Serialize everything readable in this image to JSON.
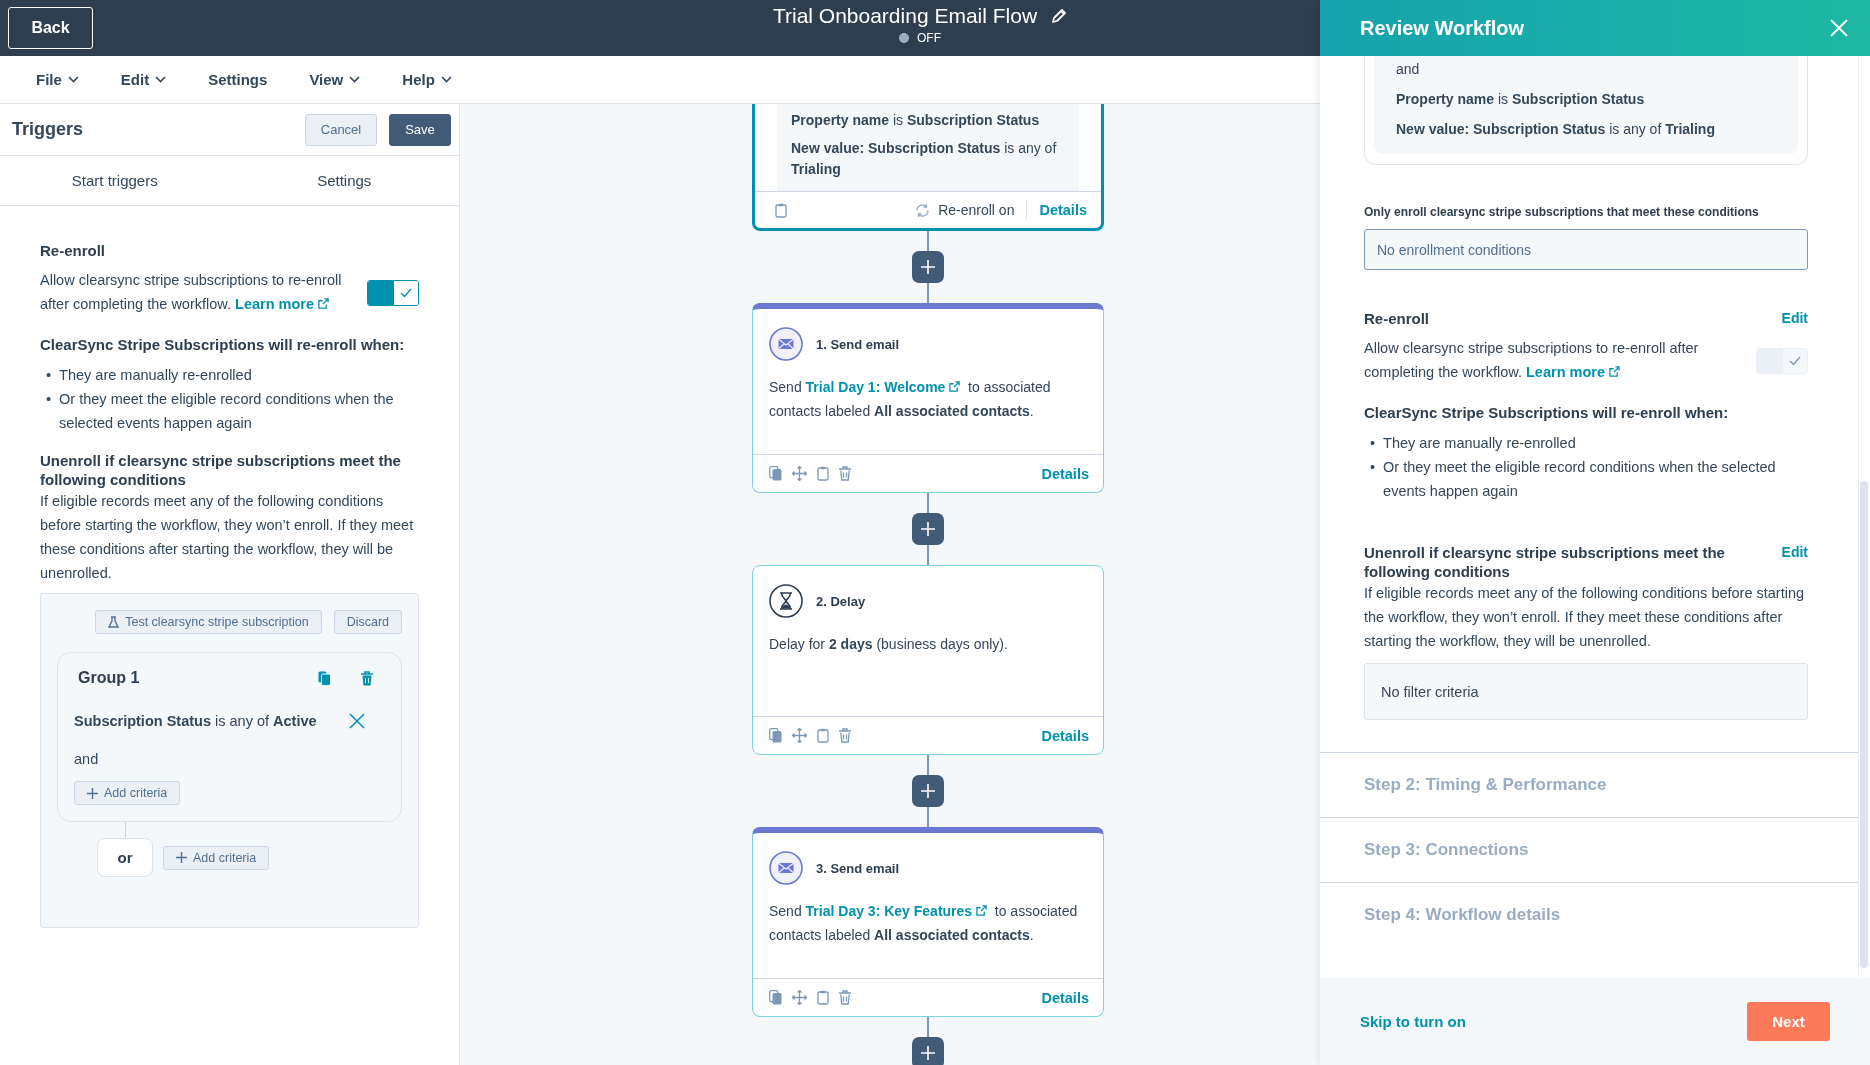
{
  "top_bar": {
    "back": "Back",
    "title": "Trial Onboarding Email Flow",
    "status": "OFF",
    "is_on": false
  },
  "menu": [
    {
      "label": "File",
      "dropdown": true
    },
    {
      "label": "Edit",
      "dropdown": true
    },
    {
      "label": "Settings",
      "dropdown": false
    },
    {
      "label": "View",
      "dropdown": true
    },
    {
      "label": "Help",
      "dropdown": true
    }
  ],
  "triggers_panel": {
    "title": "Triggers",
    "cancel": "Cancel",
    "save": "Save",
    "tabs": [
      "Start triggers",
      "Settings"
    ],
    "reenroll": {
      "title": "Re-enroll",
      "text": "Allow clearsync stripe subscriptions to re-enroll after completing the workflow.",
      "link": "Learn more",
      "on": true,
      "disabled": false
    },
    "when_title": "ClearSync Stripe Subscriptions will re-enroll when:",
    "bullet_marker": "•",
    "bullets": [
      "They are manually re-enrolled",
      "Or they meet the eligible record conditions when the selected events happen again"
    ],
    "unenroll_title": "Unenroll if clearsync stripe subscriptions meet the following conditions",
    "unenroll_text": "If eligible records meet any of the following conditions before starting the workflow, they won’t enroll. If they meet these conditions after starting the workflow, they will be unenrolled.",
    "test_button": "Test clearsync stripe subscription",
    "discard": "Discard",
    "group": {
      "title": "Group 1",
      "criteria": "**Subscription Status** is any of **Active**",
      "joiner": "and",
      "add_criteria": "Add criteria"
    },
    "or": "or",
    "add_criteria": "Add criteria"
  },
  "canvas": {
    "trigger_card": {
      "lines": [
        "**Property name** is **Subscription Status**",
        "**New value: Subscription Status** is any of **Trialing**"
      ],
      "reenroll": "Re-enroll on",
      "details": "Details"
    },
    "steps": [
      {
        "kind": "email",
        "title": "1. Send email",
        "before": "Send",
        "link": "Trial Day 1: Welcome",
        "after": "to associated contacts labeled **All associated contacts**.",
        "details": "Details"
      },
      {
        "kind": "delay",
        "title": "2. Delay",
        "text": "Delay for **2 days** (business days only).",
        "details": "Details"
      },
      {
        "kind": "email",
        "title": "3. Send email",
        "before": "Send",
        "link": "Trial Day 3: Key Features",
        "after": "to associated contacts labeled **All associated contacts**.",
        "details": "Details"
      }
    ]
  },
  "review_drawer": {
    "title": "Review Workflow",
    "trigger_lines": [
      "and",
      "**Property name** is **Subscription Status**",
      "**New value: Subscription Status** is any of **Trialing**"
    ],
    "enroll_label": "Only enroll clearsync stripe subscriptions that meet these conditions",
    "enroll_value": "No enrollment conditions",
    "reenroll": {
      "title": "Re-enroll",
      "edit": "Edit",
      "text": "Allow clearsync stripe subscriptions to re-enroll after completing the workflow.",
      "link": "Learn more",
      "on": true,
      "disabled": true
    },
    "when_title": "ClearSync Stripe Subscriptions will re-enroll when:",
    "bullet_marker": "•",
    "bullets": [
      "They are manually re-enrolled",
      "Or they meet the eligible record conditions when the selected events happen again"
    ],
    "unenroll_title": "Unenroll if clearsync stripe subscriptions meet the following conditions",
    "unenroll_edit": "Edit",
    "unenroll_text": "If eligible records meet any of the following conditions before starting the workflow, they won’t enroll. If they meet these conditions after starting the workflow, they will be unenrolled.",
    "filter": "No filter criteria",
    "steps": [
      "Step 2: Timing & Performance",
      "Step 3: Connections",
      "Step 4: Workflow details"
    ],
    "skip": "Skip to turn on",
    "next": "Next"
  }
}
